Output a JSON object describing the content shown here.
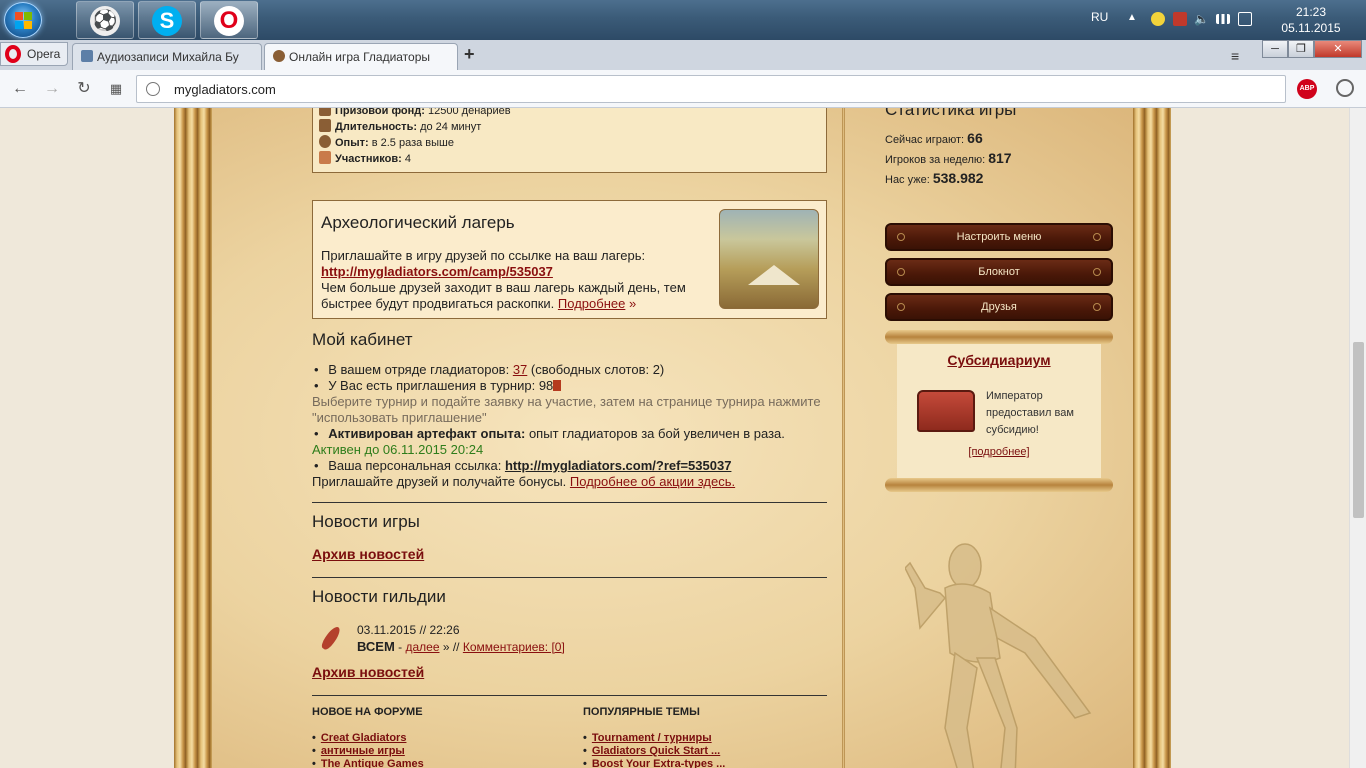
{
  "taskbar": {
    "lang": "RU",
    "time": "21:23",
    "date": "05.11.2015",
    "apps": [
      "football-app-icon",
      "skype-icon",
      "opera-icon"
    ]
  },
  "browser": {
    "menu_label": "Opera",
    "tabs": [
      {
        "title": "Аудиозаписи Михайла Бу",
        "favicon": "video-icon",
        "active": false
      },
      {
        "title": "Онлайн игра Гладиаторы",
        "favicon": "gladiator-icon",
        "active": true
      }
    ],
    "url": "mygladiators.com"
  },
  "tournament": {
    "prize_label": "Призовой фонд:",
    "prize_value": "12500 денариев",
    "duration_label": "Длительность:",
    "duration_value": "до 24 минут",
    "exp_label": "Опыт:",
    "exp_value": "в 2.5 раза выше",
    "participants_label": "Участников:",
    "participants_value": "4"
  },
  "camp": {
    "title": "Археологический лагерь",
    "line1": "Приглашайте в игру друзей по ссылке на ваш лагерь:",
    "link": "http://mygladiators.com/camp/535037",
    "line2": "Чем больше друзей заходит в ваш лагерь каждый день, тем быстрее будут продвигаться раскопки.",
    "more": "Подробнее",
    "more_arrow": "»"
  },
  "cabinet": {
    "title": "Мой кабинет",
    "squad_prefix": "В вашем отряде гладиаторов:",
    "squad_count": "37",
    "squad_suffix": "(свободных слотов: 2)",
    "invites_prefix": "У Вас есть приглашения в турнир:",
    "invites_count": "98",
    "invites_hint": "Выберите турнир и подайте заявку на участие, затем на странице турнира нажмите \"использовать приглашение\"",
    "artifact_label": "Активирован артефакт опыта:",
    "artifact_text": "опыт гладиаторов за бой увеличен в раза.",
    "active_until": "Активен до 06.11.2015 20:24",
    "ref_prefix": "Ваша персональная ссылка:",
    "ref_link": "http://mygladiators.com/?ref=535037",
    "ref_hint": "Приглашайте друзей и получайте бонусы.",
    "ref_more": "Подробнее об акции здесь."
  },
  "news": {
    "game_title": "Новости игры",
    "archive": "Архив новостей",
    "guild_title": "Новости гильдии",
    "guild_item": {
      "datetime": "03.11.2015 // 22:26",
      "who": "ВСЕМ",
      "dash": "-",
      "more": "далее",
      "sep": "» //",
      "comments": "Комментариев: [0]"
    },
    "archive2": "Архив новостей"
  },
  "forum": {
    "new_title": "НОВОЕ НА ФОРУМЕ",
    "new_items": [
      "Creat Gladiators",
      "античные игры",
      "The Antique Games"
    ],
    "popular_title": "ПОПУЛЯРНЫЕ ТЕМЫ",
    "popular_items": [
      "Tournament / турниры",
      "Gladiators Quick Start ...",
      "Boost Your Extra-types ..."
    ]
  },
  "stats": {
    "title": "Статистика игры",
    "playing_label": "Сейчас играют:",
    "playing_value": "66",
    "week_label": "Игроков за неделю:",
    "week_value": "817",
    "total_label": "Нас уже:",
    "total_value": "538.982"
  },
  "menu": {
    "configure": "Настроить меню",
    "notebook": "Блокнот",
    "friends": "Друзья"
  },
  "subsidy": {
    "title": "Субсидиариум",
    "text": "Император предоставил вам субсидию!",
    "more": "[подробнее]"
  }
}
